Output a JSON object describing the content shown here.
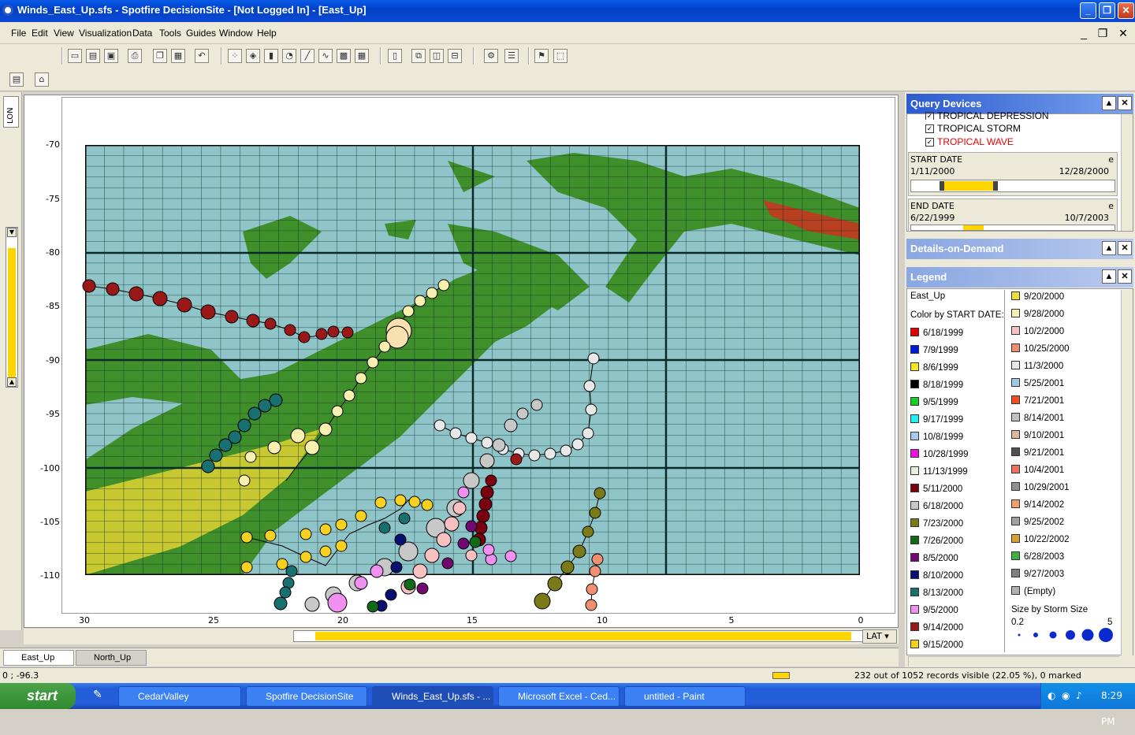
{
  "window": {
    "title": "Winds_East_Up.sfs - Spotfire DecisionSite - [Not Logged In] - [East_Up]"
  },
  "menu": [
    "File",
    "Edit",
    "View",
    "Visualization",
    "Data",
    "Tools",
    "Guides",
    "Window",
    "Help"
  ],
  "plot": {
    "y_axis_label": "LON",
    "x_axis_label": "LAT",
    "y_ticks": [
      "-70",
      "-75",
      "-80",
      "-85",
      "-90",
      "-95",
      "-100",
      "-105",
      "-110"
    ],
    "x_ticks": [
      "30",
      "25",
      "20",
      "15",
      "10",
      "5",
      "0"
    ]
  },
  "tabs": [
    "East_Up",
    "North_Up"
  ],
  "query_devices": {
    "title": "Query Devices",
    "checks": [
      {
        "label": "TROPICAL DEPRESSION",
        "checked": true,
        "color": "#000000"
      },
      {
        "label": "TROPICAL STORM",
        "checked": true,
        "color": "#000000"
      },
      {
        "label": "TROPICAL WAVE",
        "checked": true,
        "color": "#e00000"
      }
    ],
    "start_date": {
      "label": "START DATE",
      "min": "1/11/2000",
      "max": "12/28/2000",
      "mark": "e"
    },
    "end_date": {
      "label": "END DATE",
      "min": "6/22/1999",
      "max": "10/7/2003",
      "mark": "e"
    }
  },
  "details": {
    "title": "Details-on-Demand"
  },
  "legend": {
    "title": "Legend",
    "view": "East_Up",
    "color_by": "Color by START DATE:",
    "col1": [
      {
        "label": "6/18/1999",
        "color": "#e00000"
      },
      {
        "label": "7/9/1999",
        "color": "#0018d8"
      },
      {
        "label": "8/6/1999",
        "color": "#f6e820"
      },
      {
        "label": "8/18/1999",
        "color": "#000000"
      },
      {
        "label": "9/5/1999",
        "color": "#18d020"
      },
      {
        "label": "9/17/1999",
        "color": "#20f0f0"
      },
      {
        "label": "10/8/1999",
        "color": "#a8c8f0"
      },
      {
        "label": "10/28/1999",
        "color": "#f010e0"
      },
      {
        "label": "11/13/1999",
        "color": "#e8f0e0"
      },
      {
        "label": "5/11/2000",
        "color": "#7a0010"
      },
      {
        "label": "6/18/2000",
        "color": "#c8c8c8"
      },
      {
        "label": "7/23/2000",
        "color": "#7a7a18"
      },
      {
        "label": "7/26/2000",
        "color": "#106a18"
      },
      {
        "label": "8/5/2000",
        "color": "#700a70"
      },
      {
        "label": "8/10/2000",
        "color": "#0a1070"
      },
      {
        "label": "8/13/2000",
        "color": "#187070"
      },
      {
        "label": "9/5/2000",
        "color": "#f090f0"
      },
      {
        "label": "9/14/2000",
        "color": "#9a1818"
      },
      {
        "label": "9/15/2000",
        "color": "#f8d020"
      }
    ],
    "col2": [
      {
        "label": "9/20/2000",
        "color": "#e8e040"
      },
      {
        "label": "9/28/2000",
        "color": "#f8f0b0"
      },
      {
        "label": "10/2/2000",
        "color": "#f8c0c0"
      },
      {
        "label": "10/25/2000",
        "color": "#f09070"
      },
      {
        "label": "11/3/2000",
        "color": "#e8e8e8"
      },
      {
        "label": "5/25/2001",
        "color": "#a0c8e0"
      },
      {
        "label": "7/21/2001",
        "color": "#f05020"
      },
      {
        "label": "8/14/2001",
        "color": "#c0c0c0"
      },
      {
        "label": "9/10/2001",
        "color": "#d8b8a0"
      },
      {
        "label": "9/21/2001",
        "color": "#505050"
      },
      {
        "label": "10/4/2001",
        "color": "#f07060"
      },
      {
        "label": "10/29/2001",
        "color": "#909090"
      },
      {
        "label": "9/14/2002",
        "color": "#f0a070"
      },
      {
        "label": "9/25/2002",
        "color": "#a0a0a0"
      },
      {
        "label": "10/22/2002",
        "color": "#d8a030"
      },
      {
        "label": "6/28/2003",
        "color": "#40b040"
      },
      {
        "label": "9/27/2003",
        "color": "#808080"
      },
      {
        "label": "(Empty)",
        "color": "#b0b0b0"
      }
    ],
    "size_by": "Size by Storm Size",
    "size_min": "0.2",
    "size_max": "5"
  },
  "status": {
    "coords": "0 ; -96.3",
    "records": "232 out of 1052 records visible (22.05 %), 0 marked"
  },
  "taskbar": {
    "start": "start",
    "tasks": [
      "CedarValley",
      "Spotfire DecisionSite",
      "Winds_East_Up.sfs - ...",
      "Microsoft Excel - Ced...",
      "untitled - Paint"
    ],
    "clock": "8:29 PM"
  }
}
